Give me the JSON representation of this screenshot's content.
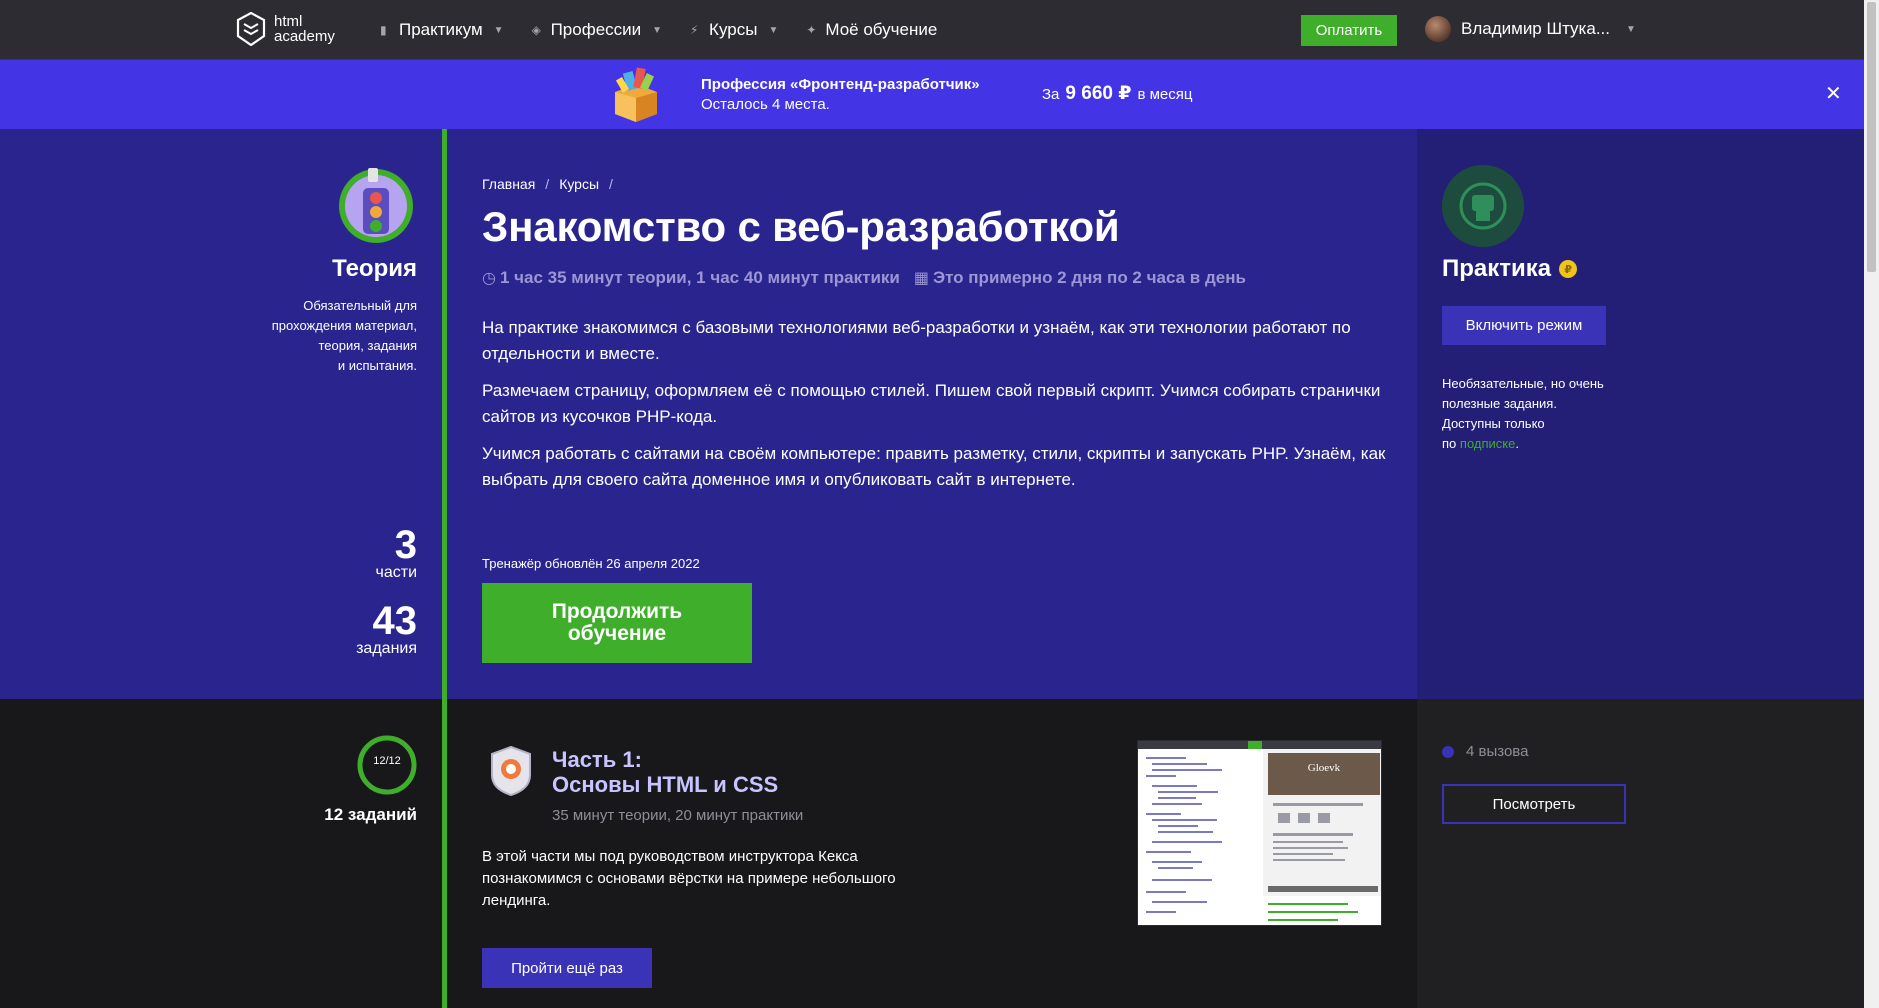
{
  "header": {
    "logo_text_line1": "html",
    "logo_text_line2": "academy",
    "nav": [
      {
        "label": "Практикум"
      },
      {
        "label": "Профессии"
      },
      {
        "label": "Курсы"
      },
      {
        "label": "Моё обучение"
      }
    ],
    "pay_label": "Оплатить",
    "user_name": "Владимир Штука..."
  },
  "promo": {
    "title": "Профессия «Фронтенд-разработчик»",
    "subtitle": "Осталось 4 места.",
    "price_prefix": "За",
    "price": "9 660 ₽",
    "price_suffix": "в месяц",
    "close": "✕"
  },
  "theory": {
    "title": "Теория",
    "desc_l1": "Обязательный для",
    "desc_l2": "прохождения материал,",
    "desc_l3": "теория, задания",
    "desc_l4": "и испытания.",
    "parts_num": "3",
    "parts_lbl": "части",
    "tasks_num": "43",
    "tasks_lbl": "задания"
  },
  "course": {
    "breadcrumb": [
      "Главная",
      "Курсы"
    ],
    "title": "Знакомство с веб-разработкой",
    "duration": "1 час 35 минут теории, 1 час 40 минут практики",
    "schedule": "Это примерно 2 дня по 2 часа в день",
    "paragraphs": [
      "На практике знакомимся с базовыми технологиями веб-разработки и узнаём, как эти технологии работают по отдельности и вместе.",
      "Размечаем страницу, оформляем её с помощью стилей. Пишем свой первый скрипт. Учимся собирать странички сайтов из кусочков PHP-кода.",
      "Учимся работать с сайтами на своём компьютере: править разметку, стили, скрипты и запускать PHP. Узнаём, как выбрать для своего сайта доменное имя и опубликовать сайт в интернете."
    ],
    "updated": "Тренажёр обновлён 26 апреля 2022",
    "continue_l1": "Продолжить",
    "continue_l2": "обучение"
  },
  "practice": {
    "title": "Практика",
    "coin": "₽",
    "mode_button": "Включить режим",
    "desc_l1": "Необязательные, но очень",
    "desc_l2": "полезные задания.",
    "desc_l3": "Доступны только",
    "desc_l4_prefix": "по",
    "desc_l4_link": "подписке",
    "desc_l4_suffix": "."
  },
  "part1": {
    "progress": "12/12",
    "progress_fraction": 1.0,
    "tasks": "12 заданий",
    "title_l1": "Часть 1:",
    "title_l2": "Основы HTML и CSS",
    "meta": "35 минут теории, 20 минут практики",
    "desc": "В этой части мы под руководством инструктора Кекса познакомимся с основами вёрстки на примере небольшого лендинга.",
    "again_button": "Пройти ещё раз",
    "thumb_site_name": "Gloevk",
    "challenges": "4 вызова",
    "view_button": "Посмотреть"
  },
  "colors": {
    "accent_green": "#3fae2a",
    "hero_bg": "#2a248e",
    "promo_bg": "#4334e6",
    "button_purple": "#3a33b8"
  }
}
